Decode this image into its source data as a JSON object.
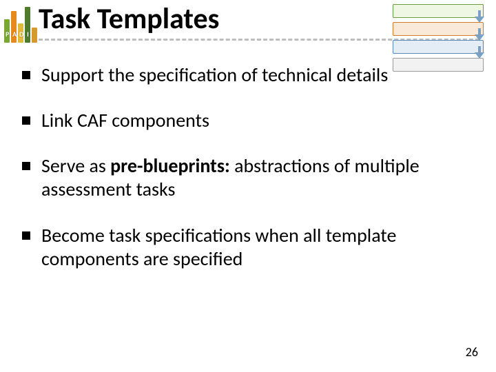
{
  "logo": {
    "letters": [
      "P",
      "A",
      "D",
      "I"
    ]
  },
  "title": "Task Templates",
  "bullets": [
    {
      "pre": "Support the specification of technical details",
      "bold": "",
      "post": ""
    },
    {
      "pre": "Link CAF components",
      "bold": "",
      "post": ""
    },
    {
      "pre": "Serve as ",
      "bold": "pre-blueprints:",
      "post": " abstractions of multiple assessment tasks"
    },
    {
      "pre": "Become task specifications when all template components are specified",
      "bold": "",
      "post": ""
    }
  ],
  "page_number": "26"
}
